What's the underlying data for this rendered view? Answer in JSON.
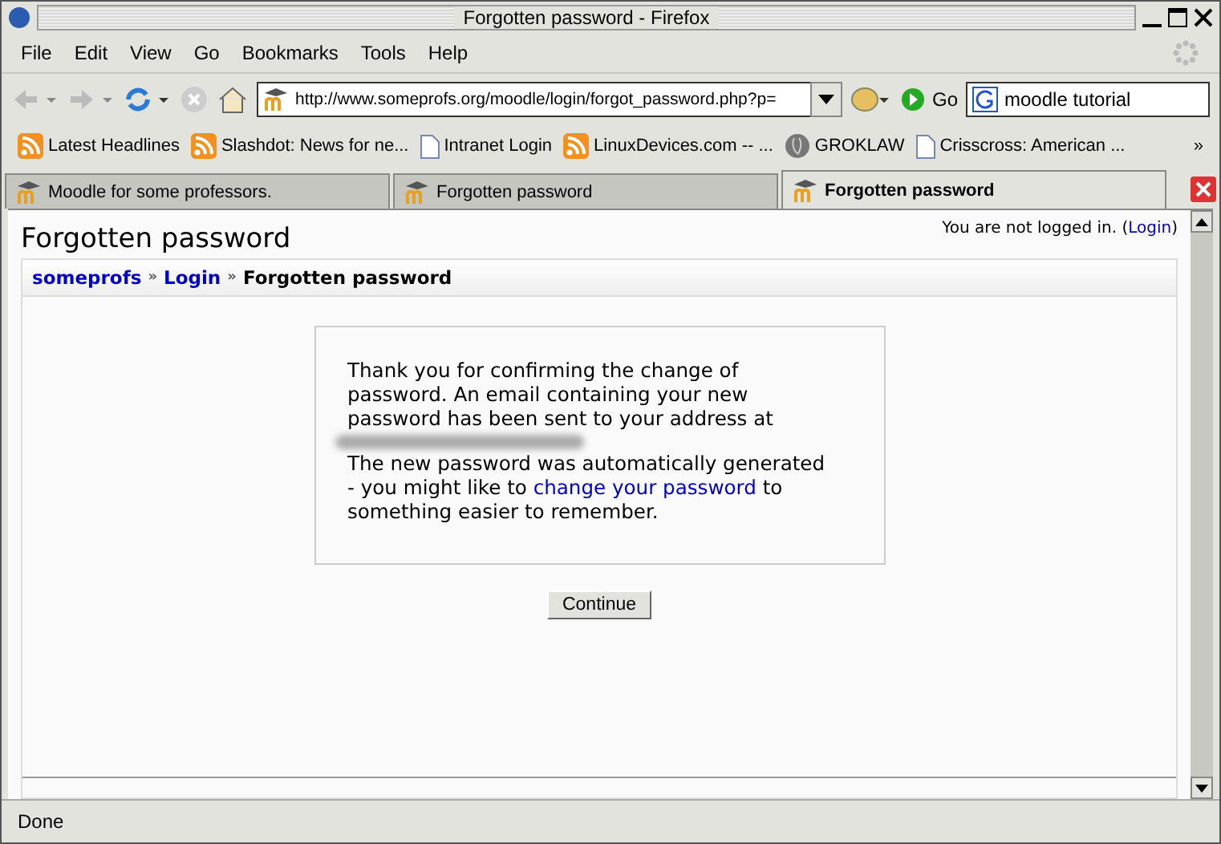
{
  "window": {
    "title": "Forgotten password - Firefox"
  },
  "menu": [
    "File",
    "Edit",
    "View",
    "Go",
    "Bookmarks",
    "Tools",
    "Help"
  ],
  "toolbar": {
    "url": "http://www.someprofs.org/moodle/login/forgot_password.php?p=",
    "go": "Go",
    "search": "moodle tutorial"
  },
  "bookmarks": [
    {
      "label": "Latest Headlines",
      "kind": "feed"
    },
    {
      "label": "Slashdot: News for ne...",
      "kind": "feed"
    },
    {
      "label": "Intranet Login",
      "kind": "page"
    },
    {
      "label": "LinuxDevices.com -- ...",
      "kind": "feed"
    },
    {
      "label": "GROKLAW",
      "kind": "site"
    },
    {
      "label": "Crisscross: American ...",
      "kind": "page"
    }
  ],
  "bookmarks_more": "»",
  "tabs": [
    {
      "label": "Moodle for some professors.",
      "selected": false
    },
    {
      "label": "Forgotten password",
      "selected": false
    },
    {
      "label": "Forgotten password",
      "selected": true
    }
  ],
  "page": {
    "heading": "Forgotten password",
    "login_info": "You are not logged in. (",
    "login_link": "Login",
    "login_close": ")",
    "breadcrumb": [
      {
        "label": "someprofs",
        "link": true
      },
      {
        "label": "Login",
        "link": true
      },
      {
        "label": "Forgotten password",
        "link": false
      }
    ],
    "breadcrumb_sep": "»",
    "message_1": "Thank you for confirming the change of password. An email containing your new password has been sent to your address at",
    "message_2": "The new password was automatically generated - you might like to ",
    "message_link": "change your password",
    "message_3": " to something easier to remember.",
    "button": "Continue"
  },
  "status_bar": "Done"
}
